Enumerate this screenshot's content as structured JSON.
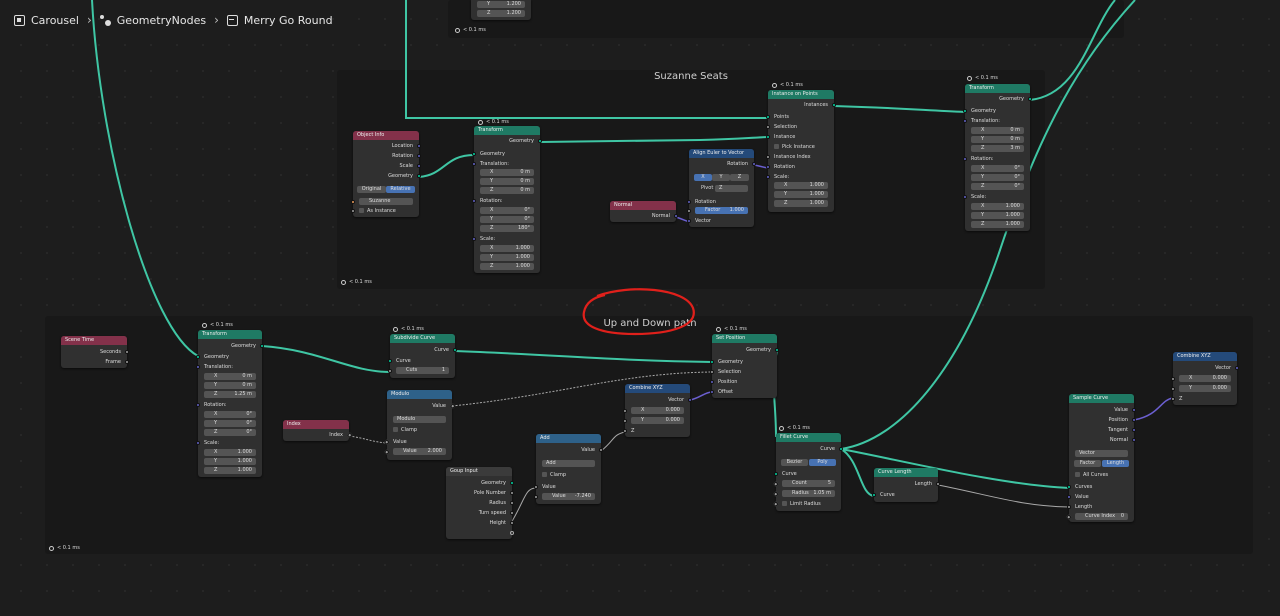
{
  "breadcrumb": {
    "object": "Carousel",
    "modifier": "GeometryNodes",
    "tree": "Merry Go Round"
  },
  "timer": "< 0.1 ms",
  "frames": {
    "seats": "Suzanne Seats",
    "path": "Up and Down path"
  },
  "top_partial": {
    "y_label": "Y",
    "y_value": "1.200",
    "z_label": "Z",
    "z_value": "1.200"
  },
  "object_info": {
    "title": "Object Info",
    "outputs": [
      "Location",
      "Rotation",
      "Scale",
      "Geometry"
    ],
    "mode_original": "Original",
    "mode_relative": "Relative",
    "object": "Suzanne",
    "as_instance": "As Instance"
  },
  "transform_seats": {
    "title": "Transform",
    "out": "Geometry",
    "in": "Geometry",
    "translation": "Translation:",
    "t": [
      [
        "X",
        "0 m"
      ],
      [
        "Y",
        "0 m"
      ],
      [
        "Z",
        "0 m"
      ]
    ],
    "rotation": "Rotation:",
    "r": [
      [
        "X",
        "0°"
      ],
      [
        "Y",
        "0°"
      ],
      [
        "Z",
        "180°"
      ]
    ],
    "scale": "Scale:",
    "s": [
      [
        "X",
        "1.000"
      ],
      [
        "Y",
        "1.000"
      ],
      [
        "Z",
        "1.000"
      ]
    ]
  },
  "align_euler": {
    "title": "Align Euler to Vector",
    "out": "Rotation",
    "axes": [
      "X",
      "Y",
      "Z"
    ],
    "pivot_label": "Pivot",
    "pivot_value": "Z",
    "in_rotation": "Rotation",
    "factor_label": "Factor",
    "factor_value": "1.000",
    "in_vector": "Vector"
  },
  "normal": {
    "title": "Normal",
    "out": "Normal"
  },
  "instance_on_points": {
    "title": "Instance on Points",
    "out": "Instances",
    "inputs": [
      "Points",
      "Selection",
      "Instance",
      "Pick Instance",
      "Instance Index",
      "Rotation",
      "Scale:"
    ],
    "s": [
      [
        "X",
        "1.000"
      ],
      [
        "Y",
        "1.000"
      ],
      [
        "Z",
        "1.000"
      ]
    ]
  },
  "transform_out": {
    "title": "Transform",
    "out": "Geometry",
    "in": "Geometry",
    "translation": "Translation:",
    "t": [
      [
        "X",
        "0 m"
      ],
      [
        "Y",
        "0 m"
      ],
      [
        "Z",
        "3 m"
      ]
    ],
    "rotation": "Rotation:",
    "r": [
      [
        "X",
        "0°"
      ],
      [
        "Y",
        "0°"
      ],
      [
        "Z",
        "0°"
      ]
    ],
    "scale": "Scale:",
    "s": [
      [
        "X",
        "1.000"
      ],
      [
        "Y",
        "1.000"
      ],
      [
        "Z",
        "1.000"
      ]
    ]
  },
  "scene_time": {
    "title": "Scene Time",
    "outputs": [
      "Seconds",
      "Frame"
    ]
  },
  "transform_path": {
    "title": "Transform",
    "out": "Geometry",
    "in": "Geometry",
    "translation": "Translation:",
    "t": [
      [
        "X",
        "0 m"
      ],
      [
        "Y",
        "0 m"
      ],
      [
        "Z",
        "1.25 m"
      ]
    ],
    "rotation": "Rotation:",
    "r": [
      [
        "X",
        "0°"
      ],
      [
        "Y",
        "0°"
      ],
      [
        "Z",
        "0°"
      ]
    ],
    "scale": "Scale:",
    "s": [
      [
        "X",
        "1.000"
      ],
      [
        "Y",
        "1.000"
      ],
      [
        "Z",
        "1.000"
      ]
    ]
  },
  "subdivide": {
    "title": "Subdivide Curve",
    "out": "Curve",
    "in": "Curve",
    "cuts_label": "Cuts",
    "cuts_value": "1"
  },
  "index": {
    "title": "Index",
    "out": "Index"
  },
  "modulo": {
    "title": "Modulo",
    "out": "Value",
    "op": "Modulo",
    "clamp": "Clamp",
    "in": "Value",
    "value_label": "Value",
    "value": "2.000"
  },
  "group_input": {
    "title": "Goup Input",
    "outputs": [
      "Geometry",
      "Pole Number",
      "Radius",
      "Turn speed",
      "Height"
    ]
  },
  "add": {
    "title": "Add",
    "out": "Value",
    "op": "Add",
    "clamp": "Clamp",
    "in": "Value",
    "value_label": "Value",
    "value": "-7.240"
  },
  "combine_xyz_1": {
    "title": "Combine XYZ",
    "out": "Vector",
    "x_label": "X",
    "x": "0.000",
    "y_label": "Y",
    "y": "0.000",
    "z_label": "Z"
  },
  "set_position": {
    "title": "Set Position",
    "out": "Geometry",
    "inputs": [
      "Geometry",
      "Selection",
      "Position",
      "Offset"
    ]
  },
  "fillet": {
    "title": "Fillet Curve",
    "out": "Curve",
    "mode_bezier": "Bezier",
    "mode_poly": "Poly",
    "in": "Curve",
    "count_label": "Count",
    "count": "5",
    "radius_label": "Radius",
    "radius": "1.05 m",
    "limit": "Limit Radius"
  },
  "curve_length": {
    "title": "Curve Length",
    "out": "Length",
    "in": "Curve"
  },
  "sample_curve": {
    "title": "Sample Curve",
    "outputs": [
      "Value",
      "Position",
      "Tangent",
      "Normal"
    ],
    "type": "Vector",
    "mode_factor": "Factor",
    "mode_length": "Length",
    "all_curves": "All Curves",
    "inputs": [
      "Curves",
      "Value",
      "Length"
    ],
    "index_label": "Curve Index",
    "index_value": "0"
  },
  "combine_xyz_2": {
    "title": "Combine XYZ",
    "out": "Vector",
    "x_label": "X",
    "x": "0.000",
    "y_label": "Y",
    "y": "0.000",
    "z_label": "Z"
  },
  "colors": {
    "geometry_header": "#1f7a64",
    "input_header": "#83314a",
    "vector_header": "#244a7a",
    "geometry_socket": "#00d6a3",
    "vector_socket": "#6363c7",
    "annotation": "#e0201b",
    "wire_geometry": "#3fc6a4",
    "wire_vector": "#6b5fd0"
  }
}
